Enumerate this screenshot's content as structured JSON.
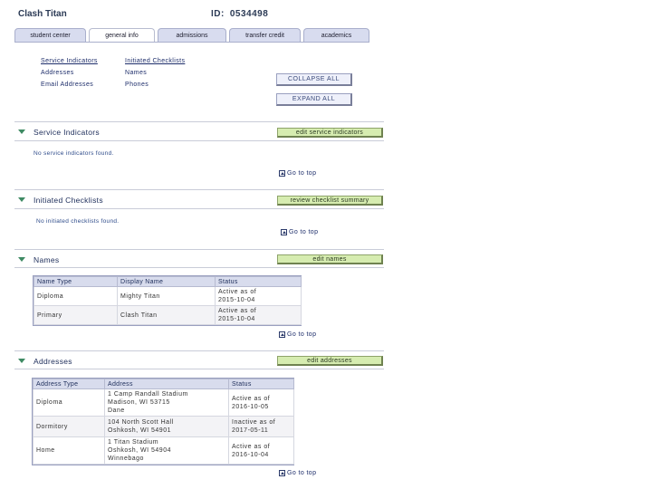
{
  "header": {
    "student_name": "Clash Titan",
    "id_label": "ID:",
    "id_value": "0534498"
  },
  "tabs": [
    {
      "label": "student center"
    },
    {
      "label": "general info"
    },
    {
      "label": "admissions"
    },
    {
      "label": "transfer credit"
    },
    {
      "label": "academics"
    }
  ],
  "quicklinks": {
    "service_indicators": "Service Indicators",
    "initiated_checklists": "Initiated Checklists",
    "addresses": "Addresses",
    "names": "Names",
    "email_addresses": "Email Addresses",
    "phones": "Phones"
  },
  "controls": {
    "collapse_all": "COLLAPSE ALL",
    "expand_all": "EXPAND ALL"
  },
  "go_to_top": "Go to top",
  "sections": {
    "service_indicators": {
      "title": "Service Indicators",
      "button": "edit service indicators",
      "message": "No service indicators found."
    },
    "checklists": {
      "title": "Initiated Checklists",
      "button": "review checklist summary",
      "message": "No initiated checklists found."
    },
    "names": {
      "title": "Names",
      "button": "edit names",
      "columns": [
        "Name Type",
        "Display Name",
        "Status"
      ],
      "rows": [
        {
          "type": "Diploma",
          "name": "Mighty Titan",
          "status1": "Active as of",
          "status2": "2015-10-04"
        },
        {
          "type": "Primary",
          "name": "Clash Titan",
          "status1": "Active as of",
          "status2": "2015-10-04"
        }
      ]
    },
    "addresses": {
      "title": "Addresses",
      "button": "edit addresses",
      "columns": [
        "Address Type",
        "Address",
        "Status"
      ],
      "rows": [
        {
          "type": "Diploma",
          "line1": "1 Camp Randall Stadium",
          "line2": "Madison, WI 53715",
          "line3": "Dane",
          "status1": "Active as of",
          "status2": "2016-10-05"
        },
        {
          "type": "Dormitory",
          "line1": "104 North Scott Hall",
          "line2": "Oshkosh, WI 54901",
          "line3": "",
          "status1": "Inactive as of",
          "status2": "2017-05-11"
        },
        {
          "type": "Home",
          "line1": "1 Titan Stadium",
          "line2": "Oshkosh, WI 54904",
          "line3": "Winnebago",
          "status1": "Active as of",
          "status2": "2016-10-04"
        }
      ]
    }
  }
}
